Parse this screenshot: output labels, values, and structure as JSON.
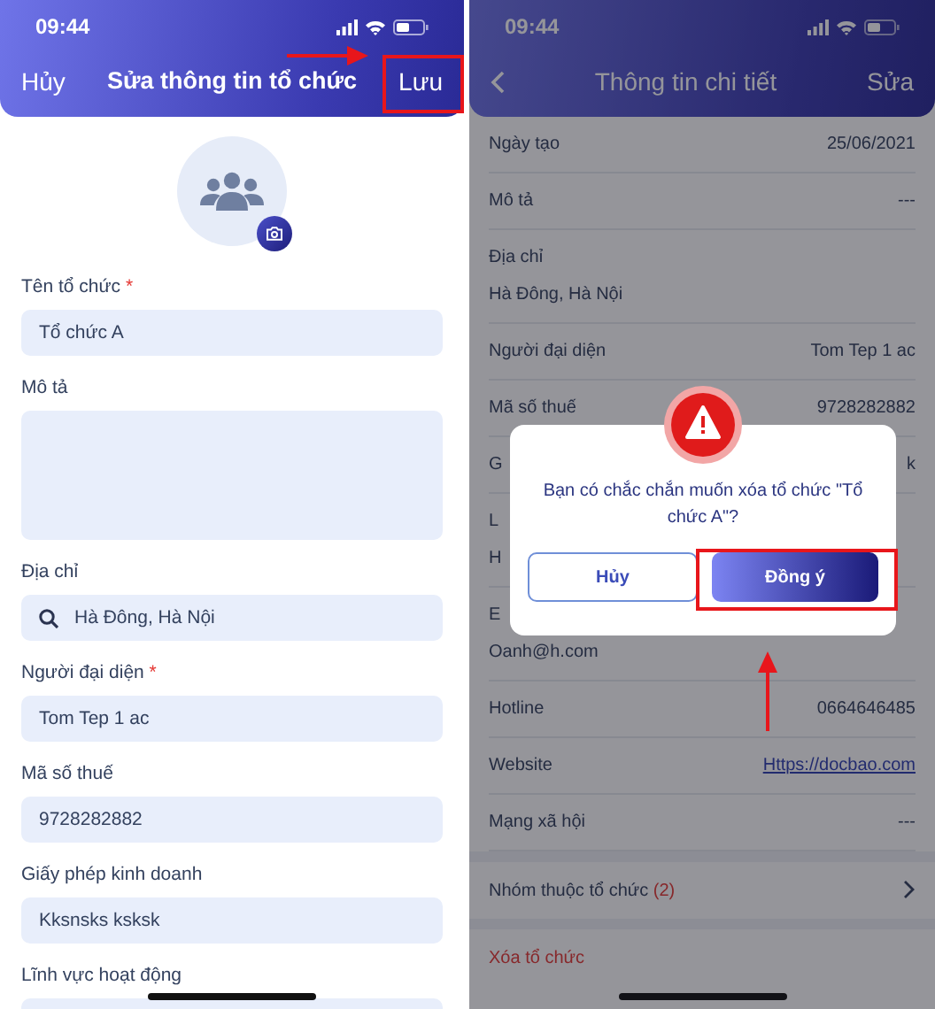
{
  "edit_screen": {
    "status_time": "09:44",
    "header": {
      "cancel": "Hủy",
      "title": "Sửa thông tin tổ chức",
      "save": "Lưu"
    },
    "required_mark": "*",
    "fields": [
      {
        "label": "Tên tổ chức",
        "required": true,
        "kind": "text",
        "value": "Tổ chức A"
      },
      {
        "label": "Mô tả",
        "required": false,
        "kind": "textarea"
      },
      {
        "label": "Địa chỉ",
        "required": false,
        "kind": "search",
        "value": "Hà Đông, Hà Nội"
      },
      {
        "label": "Người đại diện",
        "required": true,
        "kind": "text",
        "value": "Tom Tep 1 ac"
      },
      {
        "label": "Mã số thuế",
        "required": false,
        "kind": "text",
        "value": "9728282882"
      },
      {
        "label": "Giấy phép kinh doanh",
        "required": false,
        "kind": "text",
        "value": "Kksnsks ksksk"
      },
      {
        "label": "Lĩnh vực hoạt động",
        "required": false,
        "kind": "text"
      }
    ]
  },
  "detail_screen": {
    "status_time": "09:44",
    "header": {
      "title": "Thông tin chi tiết",
      "edit": "Sửa"
    },
    "rows": [
      {
        "label": "Ngày tạo",
        "value": "25/06/2021",
        "kind": "inline"
      },
      {
        "label": "Mô tả",
        "value": "---",
        "kind": "inline"
      },
      {
        "label": "Địa chỉ",
        "value": "Hà Đông, Hà Nội",
        "kind": "stacked"
      },
      {
        "label": "Người đại diện",
        "value": "Tom Tep 1 ac",
        "kind": "inline"
      },
      {
        "label": "Mã số thuế",
        "value": "9728282882",
        "kind": "inline"
      },
      {
        "label": "G",
        "value": "k",
        "kind": "inline"
      },
      {
        "label": "L",
        "value": "H",
        "kind": "stacked"
      },
      {
        "label": "E",
        "value": "Oanh@h.com",
        "kind": "stacked"
      },
      {
        "label": "Hotline",
        "value": "0664646485",
        "kind": "inline"
      },
      {
        "label": "Website",
        "value": "Https://docbao.com",
        "kind": "link"
      },
      {
        "label": "Mạng xã hội",
        "value": "---",
        "kind": "inline"
      }
    ],
    "group_row": {
      "label": "Nhóm thuộc tổ chức",
      "count": "(2)"
    },
    "delete_action": "Xóa tổ chức",
    "dialog": {
      "message": "Bạn có chắc chắn muốn xóa tổ chức \"Tổ chức A\"?",
      "cancel": "Hủy",
      "confirm": "Đồng ý"
    }
  }
}
